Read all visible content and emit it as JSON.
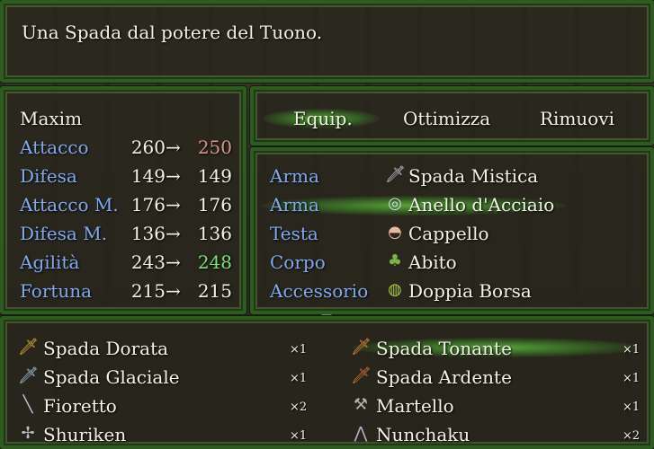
{
  "help": {
    "text": "Una Spada dal potere del Tuono."
  },
  "actor": {
    "name": "Maxim"
  },
  "stats": [
    {
      "label": "Attacco",
      "current": "260",
      "new": "250",
      "trend": "down"
    },
    {
      "label": "Difesa",
      "current": "149",
      "new": "149",
      "trend": "same"
    },
    {
      "label": "Attacco M.",
      "current": "176",
      "new": "176",
      "trend": "same"
    },
    {
      "label": "Difesa M.",
      "current": "136",
      "new": "136",
      "trend": "same"
    },
    {
      "label": "Agilità",
      "current": "243",
      "new": "248",
      "trend": "up"
    },
    {
      "label": "Fortuna",
      "current": "215",
      "new": "215",
      "trend": "same"
    }
  ],
  "arrow_glyph": "→",
  "commands": [
    {
      "label": "Equip.",
      "selected": true
    },
    {
      "label": "Ottimizza",
      "selected": false
    },
    {
      "label": "Rimuovi",
      "selected": false
    }
  ],
  "slots": [
    {
      "slot": "Arma",
      "item": "Spada Mistica",
      "icon": "sword-icon"
    },
    {
      "slot": "Arma",
      "item": "Anello d'Acciaio",
      "icon": "ring-icon"
    },
    {
      "slot": "Testa",
      "item": "Cappello",
      "icon": "hat-icon"
    },
    {
      "slot": "Corpo",
      "item": "Abito",
      "icon": "armor-icon"
    },
    {
      "slot": "Accessorio",
      "item": "Doppia Borsa",
      "icon": "bag-icon"
    }
  ],
  "items": [
    {
      "name": "Spada Dorata",
      "count": "×1",
      "icon": "gold-sword-icon"
    },
    {
      "name": "Spada Tonante",
      "count": "×1",
      "icon": "thunder-sword-icon",
      "selected": true
    },
    {
      "name": "Spada Glaciale",
      "count": "×1",
      "icon": "ice-sword-icon"
    },
    {
      "name": "Spada Ardente",
      "count": "×1",
      "icon": "fire-sword-icon"
    },
    {
      "name": "Fioretto",
      "count": "×2",
      "icon": "rapier-icon"
    },
    {
      "name": "Martello",
      "count": "×1",
      "icon": "hammer-icon"
    },
    {
      "name": "Shuriken",
      "count": "×1",
      "icon": "shuriken-icon"
    },
    {
      "name": "Nunchaku",
      "count": "×2",
      "icon": "nunchaku-icon"
    }
  ]
}
